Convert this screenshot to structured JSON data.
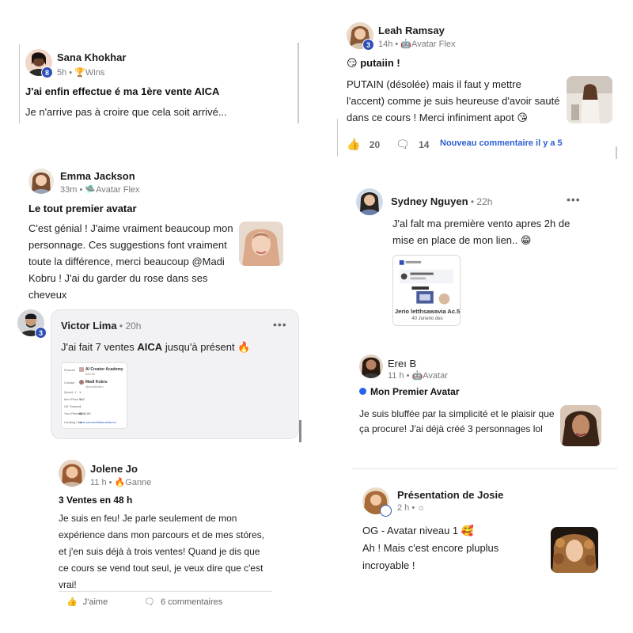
{
  "posts": {
    "sana": {
      "author": "Sana Khokhar",
      "badge": "8",
      "meta_time": "5h",
      "meta_tag": "Wins",
      "title": "J'ai enfin effectue é ma 1ère vente AICA",
      "body": "Je n'arrive pas à croire que cela soit arrivé..."
    },
    "leah": {
      "author": "Leah Ramsay",
      "badge": "3",
      "meta_time": "14h",
      "meta_tag": "Avatar Flex",
      "title": "putaiin !",
      "body": "PUTAIN (désolée)  mais il faut y mettre l'accent) comme je suis heureuse d'avoir sauté dans ce cours ! Merci infiniment apot",
      "likes": "20",
      "comments": "14",
      "new_comment": "Nouveau commentaire il y a 5"
    },
    "emma": {
      "author": "Emma Jackson",
      "meta_time": "33m",
      "meta_tag": "Avatar Flex",
      "title": "Le tout premier avatar",
      "body": "C'est génial ! J'aime vraiment beaucoup mon personnage. Ces suggestions font vraiment toute la différence, merci beaucoup @Madi Kobru ! J'ai du garder du rose dans ses cheveux"
    },
    "sydney": {
      "author": "Sydney Nguyen",
      "meta_time": "22h",
      "more": "•••",
      "body": "J'al falt ma première vento  apres 2h de mise en place de mon lien..",
      "shot_caption": "Jerio letthsawavia Ac.5-3",
      "shot_caption2": "40 Junerio des"
    },
    "victor": {
      "author": "Victor Lima",
      "badge": "3",
      "meta_time": "20h",
      "more": "•••",
      "body_pre": "J'ai fait 7 ventes ",
      "body_bold": "AICA",
      "body_post": " jusqu'à présent",
      "shot": {
        "org": "AI Creator Academy",
        "org_sub": "$40.00",
        "person": "Madi Kobru",
        "person_sub": "@madikobru",
        "rows": [
          "Product",
          "Creator",
          "Quant. 1",
          "Item Price",
          "UK Tokens",
          "Your Reward",
          "Landing Link"
        ],
        "values": [
          "1",
          "$40",
          "4",
          "$840.00",
          "ame.smozeriliatanastiw.eo"
        ]
      }
    },
    "erei": {
      "author": "Ereı B",
      "meta_time": "11 h",
      "meta_tag": "Avatar",
      "title": "Mon Premier Avatar",
      "body": "Je suis bluffée par la simplicité et le plaisir que ça procure! J'ai déjà créé 3 personnages lol"
    },
    "jolene": {
      "author": "Jolene Jo",
      "meta_time": "11 h",
      "meta_tag": "Ganne",
      "title": "3 Ventes en 48 h",
      "body": "Je suis en feu! Je parle seulement de mon expérience dans mon parcours et de mes stóres, et j'en suis déjà à trois ventes! Quand je dis que ce cours se vend tout seul, je veux dire que c'est vrai!",
      "like_label": "J'aime",
      "comments_label": "6 commentaires"
    },
    "josie": {
      "author": "Présentation de Josie",
      "meta_time": "2 h",
      "line1": "OG - Avatar niveau 1",
      "line2": "Ah ! Mais c'est encore pluplus",
      "line3": "incroyable !"
    }
  },
  "colors": {
    "badge": "#2f4fb8",
    "link": "#2f5fd0",
    "dot": "#2563eb"
  }
}
